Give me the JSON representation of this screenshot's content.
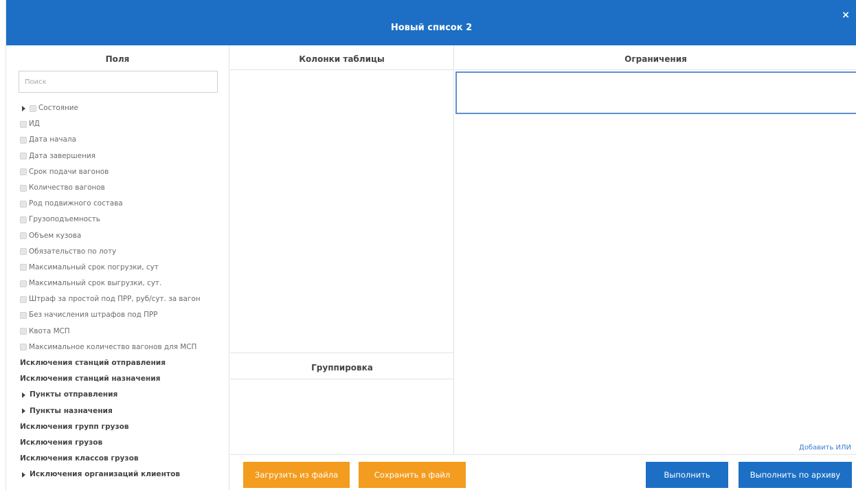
{
  "dialog": {
    "title": "Новый список 2",
    "close_symbol": "×"
  },
  "fields_panel": {
    "header": "Поля",
    "search_placeholder": "Поиск",
    "items": [
      {
        "label": "Состояние",
        "expander": true,
        "checkbox": true,
        "bold": false
      },
      {
        "label": "ИД",
        "expander": false,
        "checkbox": true,
        "bold": false
      },
      {
        "label": "Дата начала",
        "expander": false,
        "checkbox": true,
        "bold": false
      },
      {
        "label": "Дата завершения",
        "expander": false,
        "checkbox": true,
        "bold": false
      },
      {
        "label": "Срок подачи вагонов",
        "expander": false,
        "checkbox": true,
        "bold": false
      },
      {
        "label": "Количество вагонов",
        "expander": false,
        "checkbox": true,
        "bold": false
      },
      {
        "label": "Род подвижного состава",
        "expander": false,
        "checkbox": true,
        "bold": false
      },
      {
        "label": "Грузоподъемность",
        "expander": false,
        "checkbox": true,
        "bold": false
      },
      {
        "label": "Объем кузова",
        "expander": false,
        "checkbox": true,
        "bold": false
      },
      {
        "label": "Обязательство по лоту",
        "expander": false,
        "checkbox": true,
        "bold": false
      },
      {
        "label": "Максимальный срок погрузки, сут",
        "expander": false,
        "checkbox": true,
        "bold": false
      },
      {
        "label": "Максимальный срок выгрузки, сут.",
        "expander": false,
        "checkbox": true,
        "bold": false
      },
      {
        "label": "Штраф за простой под ПРР, руб/сут. за вагон",
        "expander": false,
        "checkbox": true,
        "bold": false
      },
      {
        "label": "Без начисления штрафов под ПРР",
        "expander": false,
        "checkbox": true,
        "bold": false
      },
      {
        "label": "Квота МСП",
        "expander": false,
        "checkbox": true,
        "bold": false
      },
      {
        "label": "Максимальное количество вагонов для МСП",
        "expander": false,
        "checkbox": true,
        "bold": false
      },
      {
        "label": "Исключения станций отправления",
        "expander": false,
        "checkbox": false,
        "bold": true
      },
      {
        "label": "Исключения станций назначения",
        "expander": false,
        "checkbox": false,
        "bold": true
      },
      {
        "label": "Пункты отправления",
        "expander": true,
        "checkbox": false,
        "bold": true
      },
      {
        "label": "Пункты назначения",
        "expander": true,
        "checkbox": false,
        "bold": true
      },
      {
        "label": "Исключения групп грузов",
        "expander": false,
        "checkbox": false,
        "bold": true
      },
      {
        "label": "Исключения грузов",
        "expander": false,
        "checkbox": false,
        "bold": true
      },
      {
        "label": "Исключения классов грузов",
        "expander": false,
        "checkbox": false,
        "bold": true
      },
      {
        "label": "Исключения организаций клиентов",
        "expander": true,
        "checkbox": false,
        "bold": true
      }
    ]
  },
  "columns_panel": {
    "header": "Колонки таблицы"
  },
  "grouping_panel": {
    "header": "Группировка"
  },
  "limits_panel": {
    "header": "Ограничения",
    "add_or_label": "Добавить ИЛИ"
  },
  "footer": {
    "load_button": "Загрузить из файла",
    "save_button": "Сохранить в файл",
    "run_button": "Выполнить",
    "run_archive_button": "Выполнить по архиву"
  },
  "colors": {
    "header_bg": "#1c6fc4",
    "orange_button": "#f39c1f",
    "blue_button": "#1c6fc4",
    "link": "#3a7bd5"
  }
}
